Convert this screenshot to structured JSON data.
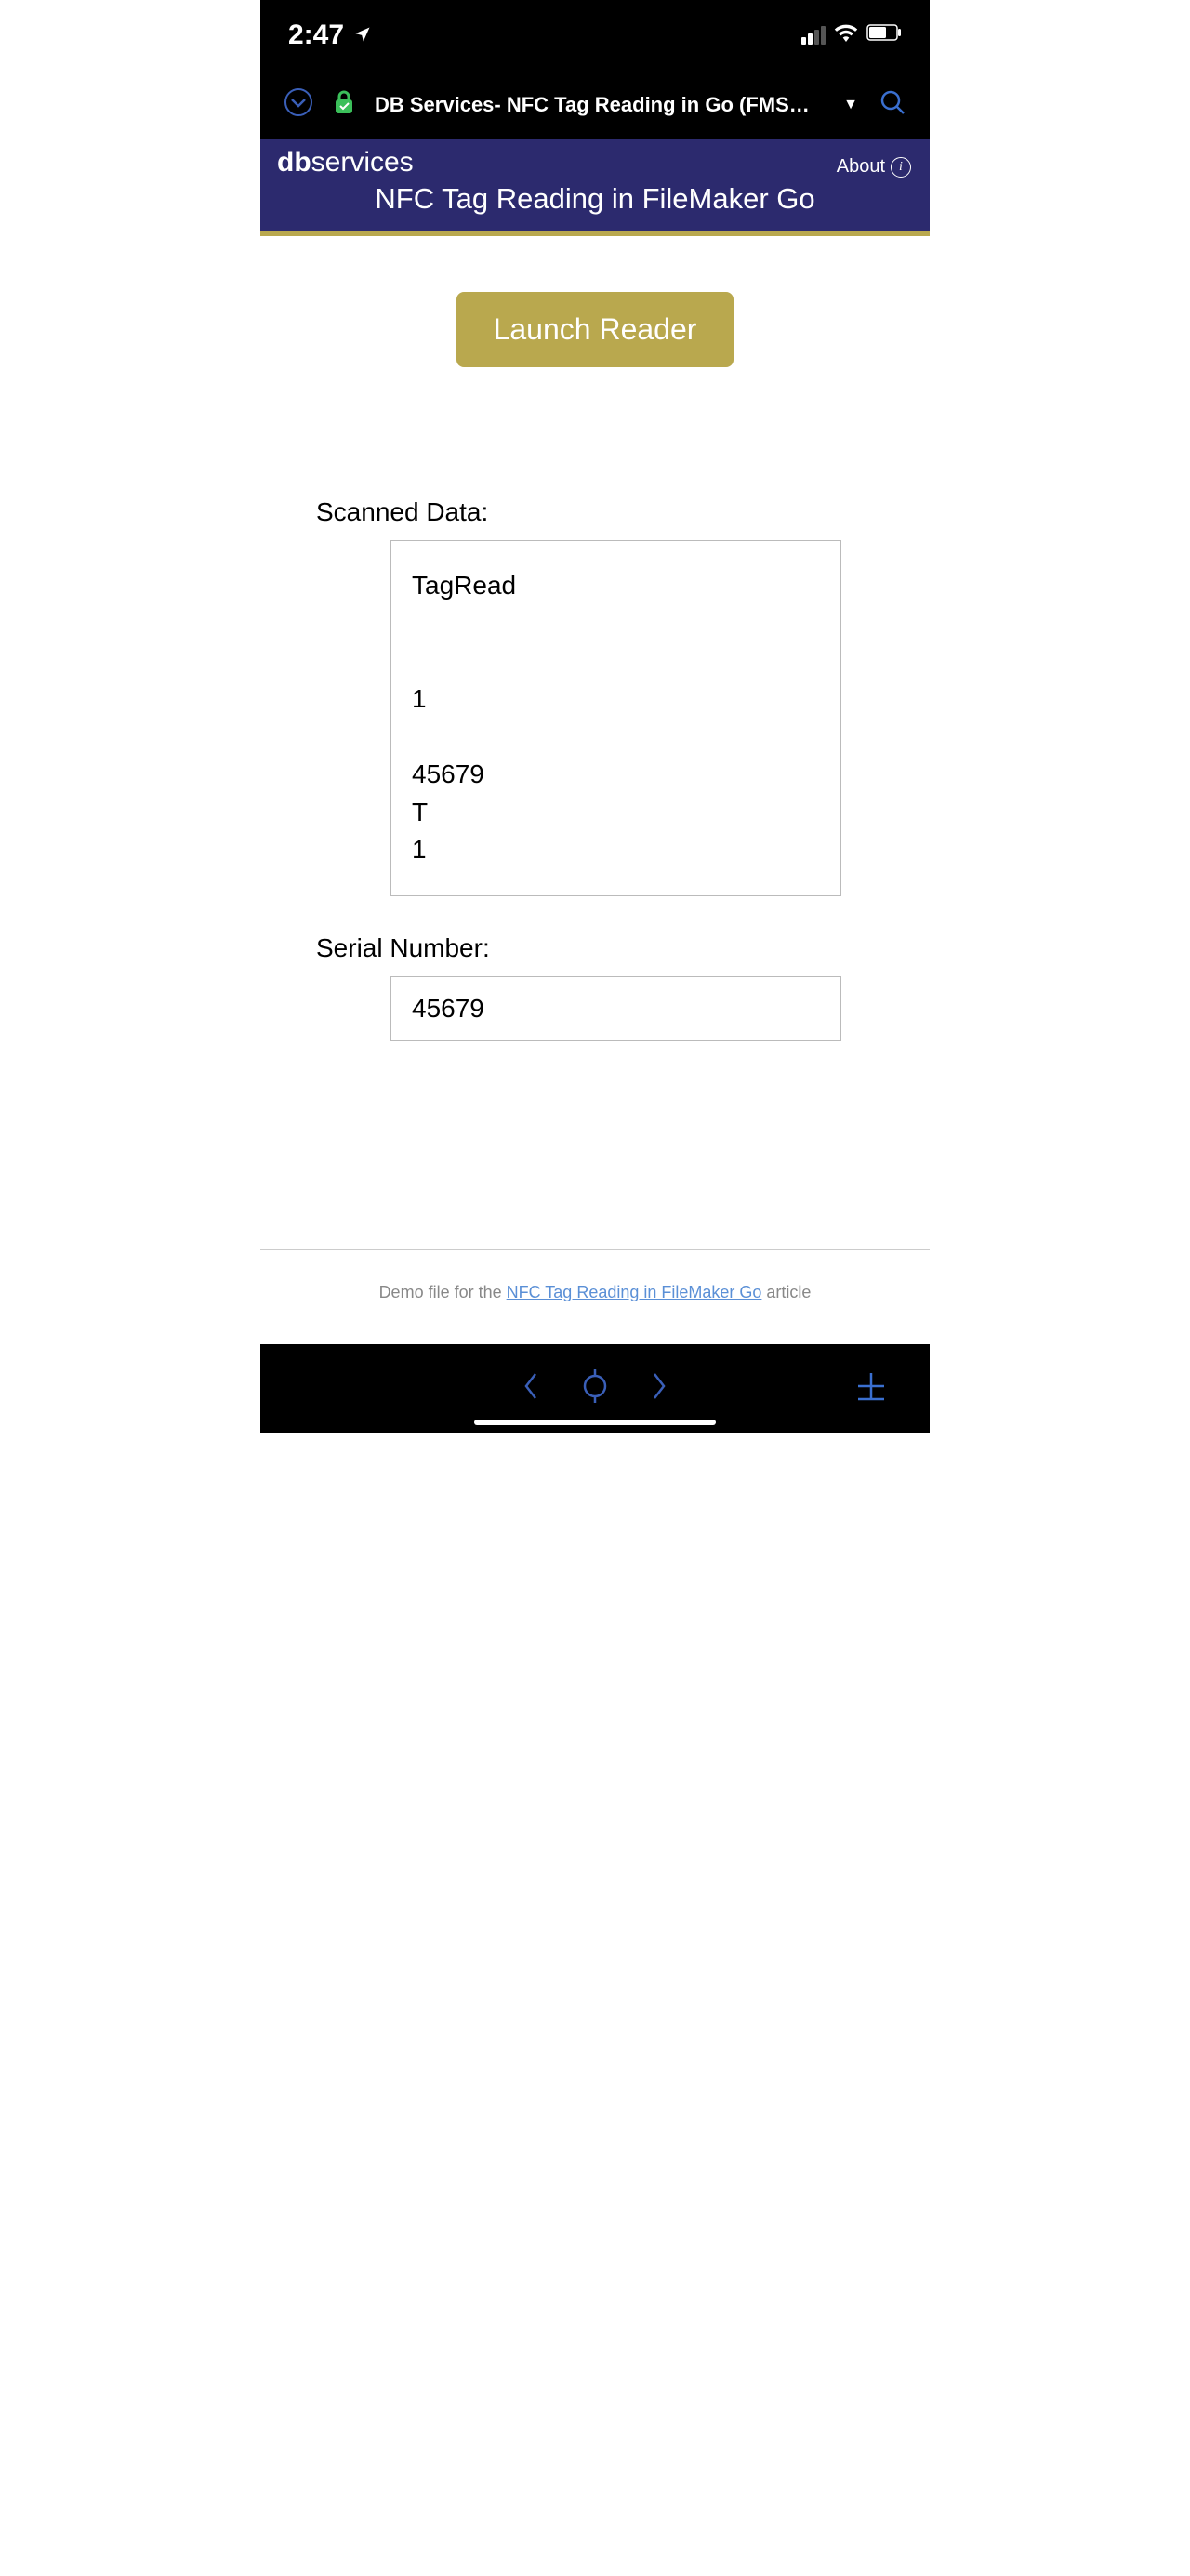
{
  "status": {
    "time": "2:47"
  },
  "toolbar": {
    "title": "DB Services- NFC Tag Reading in Go (FMSERV..."
  },
  "header": {
    "brand_bold": "db",
    "brand_light": "services",
    "page_title": "NFC Tag Reading in FileMaker Go",
    "about_label": "About",
    "info_glyph": "i"
  },
  "main": {
    "launch_label": "Launch Reader",
    "scanned_label": "Scanned Data:",
    "scanned_value": "TagRead\n\n\n1\n\n45679\nT\n1",
    "serial_label": "Serial Number:",
    "serial_value": "45679"
  },
  "footer": {
    "prefix": "Demo file for the ",
    "link_text": "NFC Tag Reading in FileMaker Go",
    "suffix": " article"
  }
}
